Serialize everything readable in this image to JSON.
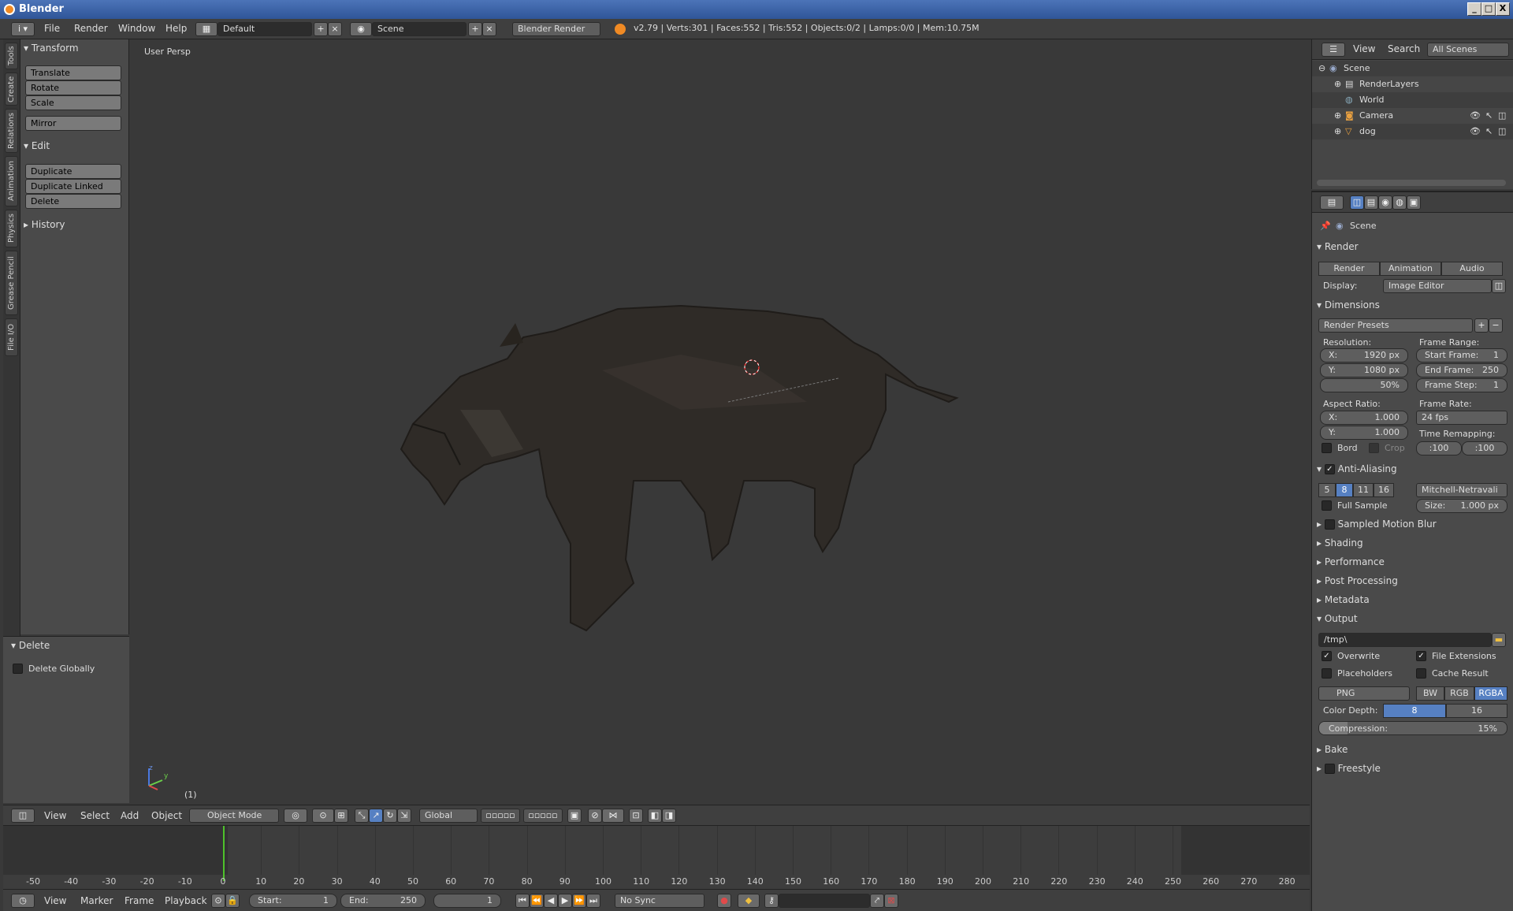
{
  "window": {
    "title": "Blender",
    "min": "_",
    "max": "□",
    "close": "X"
  },
  "topbar": {
    "menus": [
      "File",
      "Render",
      "Window",
      "Help"
    ],
    "screen_layout": "Default",
    "scene": "Scene",
    "engine": "Blender Render",
    "stats": "v2.79 | Verts:301 | Faces:552 | Tris:552 | Objects:0/2 | Lamps:0/0 | Mem:10.75M"
  },
  "vertical_tabs": [
    "Tools",
    "Create",
    "Relations",
    "Animation",
    "Physics",
    "Grease Pencil",
    "File I/O"
  ],
  "toolshelf": {
    "transform_header": "Transform",
    "transform_buttons": [
      "Translate",
      "Rotate",
      "Scale"
    ],
    "mirror": "Mirror",
    "edit_header": "Edit",
    "edit_buttons": [
      "Duplicate",
      "Duplicate Linked",
      "Delete"
    ],
    "history_header": "History"
  },
  "last_operator": {
    "header": "Delete",
    "option": "Delete Globally"
  },
  "viewport": {
    "view_label": "User Persp",
    "frame_label": "(1)",
    "axis_z": "z",
    "axis_y": "y"
  },
  "view3d_header": {
    "menus": [
      "View",
      "Select",
      "Add",
      "Object"
    ],
    "mode": "Object Mode",
    "orientation": "Global"
  },
  "timeline": {
    "ticks": [
      "-50",
      "-40",
      "-30",
      "-20",
      "-10",
      "0",
      "10",
      "20",
      "30",
      "40",
      "50",
      "60",
      "70",
      "80",
      "90",
      "100",
      "110",
      "120",
      "130",
      "140",
      "150",
      "160",
      "170",
      "180",
      "190",
      "200",
      "210",
      "220",
      "230",
      "240",
      "250",
      "260",
      "270",
      "280"
    ],
    "menus": [
      "View",
      "Marker",
      "Frame",
      "Playback"
    ],
    "start_label": "Start:",
    "start_value": "1",
    "end_label": "End:",
    "end_value": "250",
    "current_frame": "1",
    "sync": "No Sync",
    "current_frame_fraction": 0.0
  },
  "outliner": {
    "menus": [
      "View",
      "Search"
    ],
    "filter": "All Scenes",
    "items": [
      "Scene",
      "RenderLayers",
      "World",
      "Camera",
      "dog"
    ]
  },
  "properties": {
    "context": "Scene",
    "render_header": "Render",
    "render_buttons": [
      "Render",
      "Animation",
      "Audio"
    ],
    "display_label": "Display:",
    "display_value": "Image Editor",
    "dimensions_header": "Dimensions",
    "render_presets": "Render Presets",
    "resolution_label": "Resolution:",
    "res_x_label": "X:",
    "res_x": "1920 px",
    "res_y_label": "Y:",
    "res_y": "1080 px",
    "res_pct": "50%",
    "frame_range_label": "Frame Range:",
    "start_frame_label": "Start Frame:",
    "start_frame": "1",
    "end_frame_label": "End Frame:",
    "end_frame": "250",
    "frame_step_label": "Frame Step:",
    "frame_step": "1",
    "aspect_label": "Aspect Ratio:",
    "aspect_x_label": "X:",
    "aspect_x": "1.000",
    "aspect_y_label": "Y:",
    "aspect_y": "1.000",
    "frame_rate_label": "Frame Rate:",
    "frame_rate": "24 fps",
    "time_remap_label": "Time Remapping:",
    "remap_old": ":100",
    "remap_new": ":100",
    "bord": "Bord",
    "crop": "Crop",
    "aa_header": "Anti-Aliasing",
    "aa_samples": [
      "5",
      "8",
      "11",
      "16"
    ],
    "aa_filter": "Mitchell-Netravali",
    "full_sample": "Full Sample",
    "size_label": "Size:",
    "size_value": "1.000 px",
    "sampled_motion_blur": "Sampled Motion Blur",
    "collapsed": [
      "Shading",
      "Performance",
      "Post Processing",
      "Metadata"
    ],
    "output_header": "Output",
    "output_path": "/tmp\\",
    "overwrite": "Overwrite",
    "file_extensions": "File Extensions",
    "placeholders": "Placeholders",
    "cache_result": "Cache Result",
    "format": "PNG",
    "color_modes": [
      "BW",
      "RGB",
      "RGBA"
    ],
    "color_depth_label": "Color Depth:",
    "depths": [
      "8",
      "16"
    ],
    "compression_label": "Compression:",
    "compression": "15%",
    "compression_fraction": 0.15,
    "bake": "Bake",
    "freestyle": "Freestyle"
  },
  "colors": {
    "accent": "#5680c2",
    "panel": "#4a4a4a",
    "viewport": "#393939",
    "playhead": "#4ec22a"
  }
}
